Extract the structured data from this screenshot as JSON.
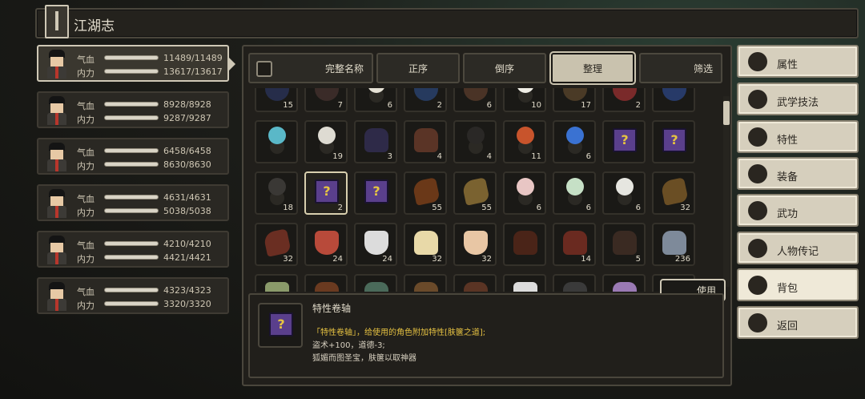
{
  "title": "江湖志",
  "characters": [
    {
      "hp_label": "气血",
      "hp": "11489/11489",
      "mp_label": "内力",
      "mp": "13617/13617",
      "hp_pct": 1,
      "mp_pct": 1
    },
    {
      "hp_label": "气血",
      "hp": "8928/8928",
      "mp_label": "内力",
      "mp": "9287/9287",
      "hp_pct": 1,
      "mp_pct": 1
    },
    {
      "hp_label": "气血",
      "hp": "6458/6458",
      "mp_label": "内力",
      "mp": "8630/8630",
      "hp_pct": 1,
      "mp_pct": 1
    },
    {
      "hp_label": "气血",
      "hp": "4631/4631",
      "mp_label": "内力",
      "mp": "5038/5038",
      "hp_pct": 1,
      "mp_pct": 1
    },
    {
      "hp_label": "气血",
      "hp": "4210/4210",
      "mp_label": "内力",
      "mp": "4421/4421",
      "hp_pct": 1,
      "mp_pct": 1
    },
    {
      "hp_label": "气血",
      "hp": "4323/4323",
      "mp_label": "内力",
      "mp": "3320/3320",
      "hp_pct": 1,
      "mp_pct": 1
    }
  ],
  "tabs": {
    "full_name": "完整名称",
    "order": "正序",
    "reverse": "倒序",
    "sort": "整理",
    "filter": "筛选"
  },
  "inventory": [
    [
      "15",
      "7",
      "6",
      "2",
      "6",
      "10",
      "17",
      "2",
      ""
    ],
    [
      "",
      "19",
      "3",
      "4",
      "4",
      "11",
      "6",
      "",
      ""
    ],
    [
      "18",
      "2",
      "",
      "55",
      "55",
      "6",
      "6",
      "6",
      "32"
    ],
    [
      "32",
      "24",
      "24",
      "32",
      "32",
      "",
      "14",
      "5",
      "236"
    ]
  ],
  "use_button": "使用",
  "detail": {
    "name": "特性卷轴",
    "line1_prefix": "「特性卷轴」，给使用的角色附加特性[",
    "line1_highlight": "肤箧之道",
    "line1_suffix": "];",
    "line2": "盗术+100，道德-3;",
    "line3": "狐媚而图圣宝，肤箧以取神器"
  },
  "menu": [
    {
      "label": "属性",
      "icon": "person-icon"
    },
    {
      "label": "武学技法",
      "icon": "skill-person-icon"
    },
    {
      "label": "特性",
      "icon": "trait-person-icon"
    },
    {
      "label": "装备",
      "icon": "sword-icon"
    },
    {
      "label": "武功",
      "icon": "book-icon"
    },
    {
      "label": "人物传记",
      "icon": "biography-icon"
    },
    {
      "label": "背包",
      "icon": "bag-icon"
    },
    {
      "label": "返回",
      "icon": "door-icon"
    }
  ],
  "colors": {
    "bag_active": "#efe9d8",
    "menu_bg": "#d6cfbd",
    "highlight": "#e5c142",
    "book": "#5a3f8c"
  }
}
